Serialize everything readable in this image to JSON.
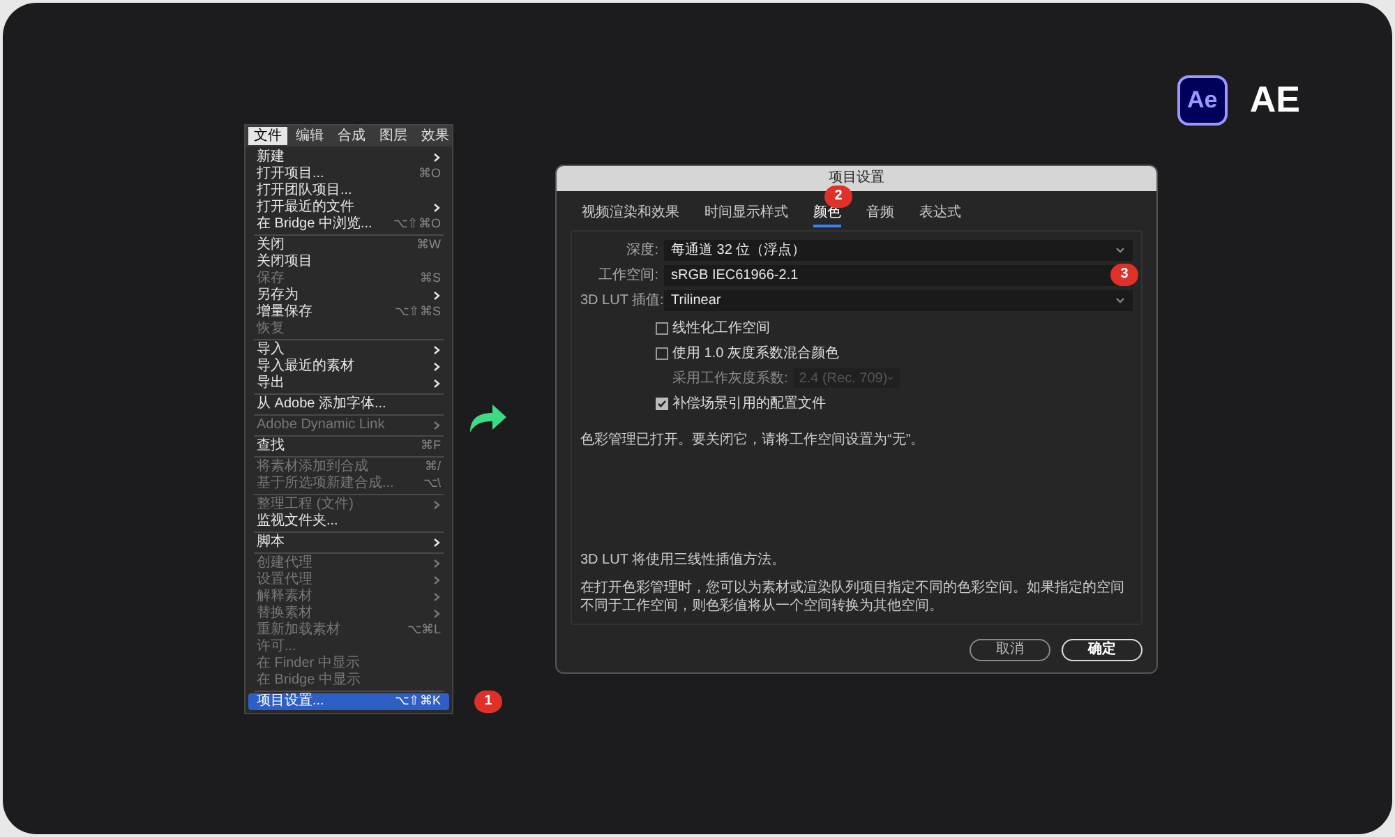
{
  "brand": {
    "logo_text": "Ae",
    "label": "AE"
  },
  "menu": {
    "menubar": [
      {
        "label": "文件",
        "selected": true
      },
      {
        "label": "编辑",
        "selected": false
      },
      {
        "label": "合成",
        "selected": false
      },
      {
        "label": "图层",
        "selected": false
      },
      {
        "label": "效果",
        "selected": false
      }
    ],
    "items": [
      {
        "kind": "item",
        "label": "新建",
        "submenu": true,
        "disabled": false,
        "selected": false
      },
      {
        "kind": "item",
        "label": "打开项目...",
        "shortcut": "⌘O",
        "submenu": false,
        "disabled": false,
        "selected": false
      },
      {
        "kind": "item",
        "label": "打开团队项目...",
        "submenu": false,
        "disabled": false,
        "selected": false
      },
      {
        "kind": "item",
        "label": "打开最近的文件",
        "submenu": true,
        "disabled": false,
        "selected": false
      },
      {
        "kind": "item",
        "label": "在 Bridge 中浏览...",
        "shortcut": "⌥⇧⌘O",
        "submenu": false,
        "disabled": false,
        "selected": false
      },
      {
        "kind": "separator"
      },
      {
        "kind": "item",
        "label": "关闭",
        "shortcut": "⌘W",
        "submenu": false,
        "disabled": false,
        "selected": false
      },
      {
        "kind": "item",
        "label": "关闭项目",
        "submenu": false,
        "disabled": false,
        "selected": false
      },
      {
        "kind": "item",
        "label": "保存",
        "shortcut": "⌘S",
        "submenu": false,
        "disabled": true,
        "selected": false
      },
      {
        "kind": "item",
        "label": "另存为",
        "submenu": true,
        "disabled": false,
        "selected": false
      },
      {
        "kind": "item",
        "label": "增量保存",
        "shortcut": "⌥⇧⌘S",
        "submenu": false,
        "disabled": false,
        "selected": false
      },
      {
        "kind": "item",
        "label": "恢复",
        "submenu": false,
        "disabled": true,
        "selected": false
      },
      {
        "kind": "separator"
      },
      {
        "kind": "item",
        "label": "导入",
        "submenu": true,
        "disabled": false,
        "selected": false
      },
      {
        "kind": "item",
        "label": "导入最近的素材",
        "submenu": true,
        "disabled": false,
        "selected": false
      },
      {
        "kind": "item",
        "label": "导出",
        "submenu": true,
        "disabled": false,
        "selected": false
      },
      {
        "kind": "separator"
      },
      {
        "kind": "item",
        "label": "从 Adobe 添加字体...",
        "submenu": false,
        "disabled": false,
        "selected": false
      },
      {
        "kind": "separator"
      },
      {
        "kind": "item",
        "label": "Adobe Dynamic Link",
        "submenu": true,
        "disabled": true,
        "selected": false
      },
      {
        "kind": "separator"
      },
      {
        "kind": "item",
        "label": "查找",
        "shortcut": "⌘F",
        "submenu": false,
        "disabled": false,
        "selected": false
      },
      {
        "kind": "separator"
      },
      {
        "kind": "item",
        "label": "将素材添加到合成",
        "shortcut": "⌘/",
        "submenu": false,
        "disabled": true,
        "selected": false
      },
      {
        "kind": "item",
        "label": "基于所选项新建合成...",
        "shortcut": "⌥\\",
        "submenu": false,
        "disabled": true,
        "selected": false
      },
      {
        "kind": "separator"
      },
      {
        "kind": "item",
        "label": "整理工程 (文件)",
        "submenu": true,
        "disabled": true,
        "selected": false
      },
      {
        "kind": "item",
        "label": "监视文件夹...",
        "submenu": false,
        "disabled": false,
        "selected": false
      },
      {
        "kind": "separator"
      },
      {
        "kind": "item",
        "label": "脚本",
        "submenu": true,
        "disabled": false,
        "selected": false
      },
      {
        "kind": "separator"
      },
      {
        "kind": "item",
        "label": "创建代理",
        "submenu": true,
        "disabled": true,
        "selected": false
      },
      {
        "kind": "item",
        "label": "设置代理",
        "submenu": true,
        "disabled": true,
        "selected": false
      },
      {
        "kind": "item",
        "label": "解释素材",
        "submenu": true,
        "disabled": true,
        "selected": false
      },
      {
        "kind": "item",
        "label": "替换素材",
        "submenu": true,
        "disabled": true,
        "selected": false
      },
      {
        "kind": "item",
        "label": "重新加载素材",
        "shortcut": "⌥⌘L",
        "submenu": false,
        "disabled": true,
        "selected": false
      },
      {
        "kind": "item",
        "label": "许可...",
        "submenu": false,
        "disabled": true,
        "selected": false
      },
      {
        "kind": "item",
        "label": "在 Finder 中显示",
        "submenu": false,
        "disabled": true,
        "selected": false
      },
      {
        "kind": "item",
        "label": "在 Bridge 中显示",
        "submenu": false,
        "disabled": true,
        "selected": false
      },
      {
        "kind": "separator"
      },
      {
        "kind": "item",
        "label": "项目设置...",
        "shortcut": "⌥⇧⌘K",
        "submenu": false,
        "disabled": false,
        "selected": true,
        "badge": "1"
      }
    ]
  },
  "dialog": {
    "title": "项目设置",
    "tabs": [
      {
        "label": "视频渲染和效果",
        "selected": false
      },
      {
        "label": "时间显示样式",
        "selected": false
      },
      {
        "label": "颜色",
        "selected": true,
        "badge": "2"
      },
      {
        "label": "音频",
        "selected": false
      },
      {
        "label": "表达式",
        "selected": false
      }
    ],
    "fields": [
      {
        "kind": "select",
        "label": "深度:",
        "value": "每通道 32 位（浮点）"
      },
      {
        "kind": "text",
        "label": "工作空间:",
        "value": "sRGB IEC61966-2.1",
        "badge": "3"
      },
      {
        "kind": "select",
        "label": "3D LUT 插值:",
        "value": "Trilinear"
      }
    ],
    "options": [
      {
        "kind": "checkbox",
        "label": "线性化工作空间",
        "checked": false
      },
      {
        "kind": "checkbox",
        "label": "使用 1.0 灰度系数混合颜色",
        "checked": false
      },
      {
        "kind": "select",
        "label": "采用工作灰度系数:",
        "value": "2.4 (Rec. 709)",
        "disabled": true
      },
      {
        "kind": "checkbox",
        "label": "补偿场景引用的配置文件",
        "checked": true
      }
    ],
    "status": "色彩管理已打开。要关闭它，请将工作空间设置为“无”。",
    "notes": [
      "3D LUT 将使用三线性插值方法。",
      "在打开色彩管理时，您可以为素材或渲染队列项目指定不同的色彩空间。如果指定的空间不同于工作空间，则色彩值将从一个空间转换为其他空间。"
    ],
    "buttons": [
      {
        "label": "取消",
        "primary": false
      },
      {
        "label": "确定",
        "primary": true
      }
    ]
  }
}
